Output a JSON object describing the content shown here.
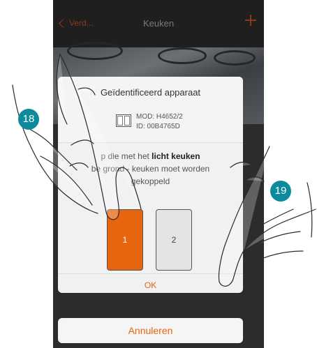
{
  "header": {
    "back_label": "Verd...",
    "title": "Keuken"
  },
  "dialog": {
    "title": "Geïdentificeerd apparaat",
    "device_model": "MOD: H4652/2",
    "device_id": "ID: 00B4765D",
    "instruction_before": "p die met het ",
    "instruction_bold": "licht keuken",
    "instruction_line2": "be  grond - keuken moet worden",
    "instruction_line3": "gekoppeld",
    "key_1_label": "1",
    "key_2_label": "2",
    "ok_label": "OK"
  },
  "cancel_label": "Annuleren",
  "badges": {
    "step_a": "18",
    "step_b": "19"
  },
  "colors": {
    "accent": "#e8650f",
    "badge": "#0d8a9b",
    "navbar": "#1f1f1f"
  }
}
